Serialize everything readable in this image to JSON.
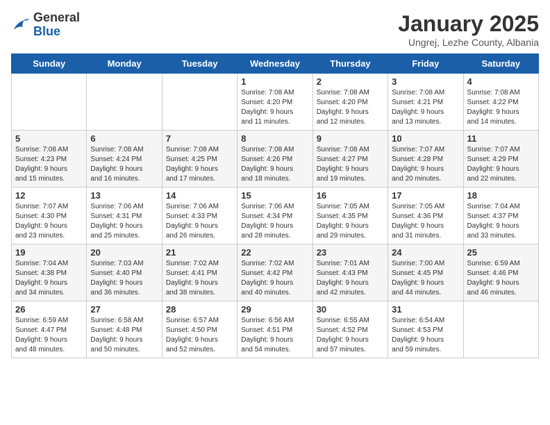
{
  "logo": {
    "general": "General",
    "blue": "Blue"
  },
  "header": {
    "title": "January 2025",
    "subtitle": "Ungrej, Lezhe County, Albania"
  },
  "days_of_week": [
    "Sunday",
    "Monday",
    "Tuesday",
    "Wednesday",
    "Thursday",
    "Friday",
    "Saturday"
  ],
  "weeks": [
    [
      {
        "day": "",
        "info": ""
      },
      {
        "day": "",
        "info": ""
      },
      {
        "day": "",
        "info": ""
      },
      {
        "day": "1",
        "info": "Sunrise: 7:08 AM\nSunset: 4:20 PM\nDaylight: 9 hours\nand 11 minutes."
      },
      {
        "day": "2",
        "info": "Sunrise: 7:08 AM\nSunset: 4:20 PM\nDaylight: 9 hours\nand 12 minutes."
      },
      {
        "day": "3",
        "info": "Sunrise: 7:08 AM\nSunset: 4:21 PM\nDaylight: 9 hours\nand 13 minutes."
      },
      {
        "day": "4",
        "info": "Sunrise: 7:08 AM\nSunset: 4:22 PM\nDaylight: 9 hours\nand 14 minutes."
      }
    ],
    [
      {
        "day": "5",
        "info": "Sunrise: 7:08 AM\nSunset: 4:23 PM\nDaylight: 9 hours\nand 15 minutes."
      },
      {
        "day": "6",
        "info": "Sunrise: 7:08 AM\nSunset: 4:24 PM\nDaylight: 9 hours\nand 16 minutes."
      },
      {
        "day": "7",
        "info": "Sunrise: 7:08 AM\nSunset: 4:25 PM\nDaylight: 9 hours\nand 17 minutes."
      },
      {
        "day": "8",
        "info": "Sunrise: 7:08 AM\nSunset: 4:26 PM\nDaylight: 9 hours\nand 18 minutes."
      },
      {
        "day": "9",
        "info": "Sunrise: 7:08 AM\nSunset: 4:27 PM\nDaylight: 9 hours\nand 19 minutes."
      },
      {
        "day": "10",
        "info": "Sunrise: 7:07 AM\nSunset: 4:28 PM\nDaylight: 9 hours\nand 20 minutes."
      },
      {
        "day": "11",
        "info": "Sunrise: 7:07 AM\nSunset: 4:29 PM\nDaylight: 9 hours\nand 22 minutes."
      }
    ],
    [
      {
        "day": "12",
        "info": "Sunrise: 7:07 AM\nSunset: 4:30 PM\nDaylight: 9 hours\nand 23 minutes."
      },
      {
        "day": "13",
        "info": "Sunrise: 7:06 AM\nSunset: 4:31 PM\nDaylight: 9 hours\nand 25 minutes."
      },
      {
        "day": "14",
        "info": "Sunrise: 7:06 AM\nSunset: 4:33 PM\nDaylight: 9 hours\nand 26 minutes."
      },
      {
        "day": "15",
        "info": "Sunrise: 7:06 AM\nSunset: 4:34 PM\nDaylight: 9 hours\nand 28 minutes."
      },
      {
        "day": "16",
        "info": "Sunrise: 7:05 AM\nSunset: 4:35 PM\nDaylight: 9 hours\nand 29 minutes."
      },
      {
        "day": "17",
        "info": "Sunrise: 7:05 AM\nSunset: 4:36 PM\nDaylight: 9 hours\nand 31 minutes."
      },
      {
        "day": "18",
        "info": "Sunrise: 7:04 AM\nSunset: 4:37 PM\nDaylight: 9 hours\nand 33 minutes."
      }
    ],
    [
      {
        "day": "19",
        "info": "Sunrise: 7:04 AM\nSunset: 4:38 PM\nDaylight: 9 hours\nand 34 minutes."
      },
      {
        "day": "20",
        "info": "Sunrise: 7:03 AM\nSunset: 4:40 PM\nDaylight: 9 hours\nand 36 minutes."
      },
      {
        "day": "21",
        "info": "Sunrise: 7:02 AM\nSunset: 4:41 PM\nDaylight: 9 hours\nand 38 minutes."
      },
      {
        "day": "22",
        "info": "Sunrise: 7:02 AM\nSunset: 4:42 PM\nDaylight: 9 hours\nand 40 minutes."
      },
      {
        "day": "23",
        "info": "Sunrise: 7:01 AM\nSunset: 4:43 PM\nDaylight: 9 hours\nand 42 minutes."
      },
      {
        "day": "24",
        "info": "Sunrise: 7:00 AM\nSunset: 4:45 PM\nDaylight: 9 hours\nand 44 minutes."
      },
      {
        "day": "25",
        "info": "Sunrise: 6:59 AM\nSunset: 4:46 PM\nDaylight: 9 hours\nand 46 minutes."
      }
    ],
    [
      {
        "day": "26",
        "info": "Sunrise: 6:59 AM\nSunset: 4:47 PM\nDaylight: 9 hours\nand 48 minutes."
      },
      {
        "day": "27",
        "info": "Sunrise: 6:58 AM\nSunset: 4:48 PM\nDaylight: 9 hours\nand 50 minutes."
      },
      {
        "day": "28",
        "info": "Sunrise: 6:57 AM\nSunset: 4:50 PM\nDaylight: 9 hours\nand 52 minutes."
      },
      {
        "day": "29",
        "info": "Sunrise: 6:56 AM\nSunset: 4:51 PM\nDaylight: 9 hours\nand 54 minutes."
      },
      {
        "day": "30",
        "info": "Sunrise: 6:55 AM\nSunset: 4:52 PM\nDaylight: 9 hours\nand 57 minutes."
      },
      {
        "day": "31",
        "info": "Sunrise: 6:54 AM\nSunset: 4:53 PM\nDaylight: 9 hours\nand 59 minutes."
      },
      {
        "day": "",
        "info": ""
      }
    ]
  ]
}
